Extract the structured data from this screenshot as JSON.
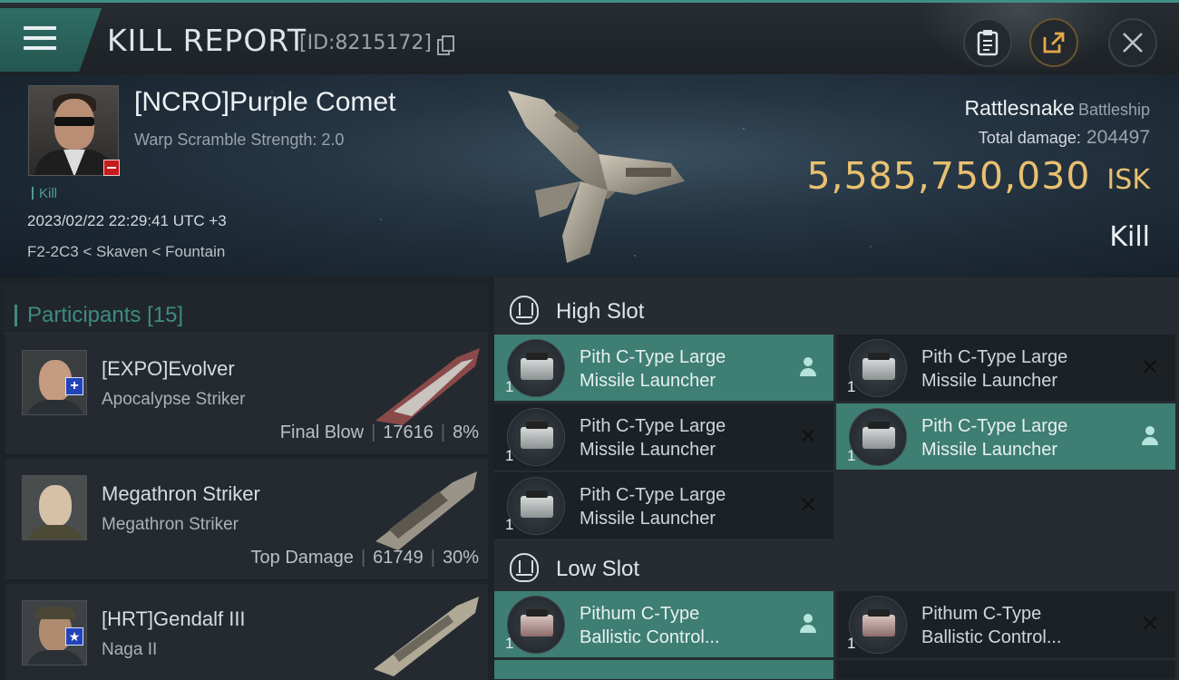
{
  "header": {
    "title": "KILL REPORT",
    "report_id": "[ID:8215172]",
    "icons": {
      "menu": "hamburger-menu-icon",
      "copy": "copy-icon",
      "clipboard": "clipboard-icon",
      "share": "share-icon",
      "close": "close-icon"
    }
  },
  "victim": {
    "name": "[NCRO]Purple Comet",
    "warp_scramble": "Warp Scramble Strength: 2.0",
    "result_tag": "Kill",
    "timestamp": "2023/02/22 22:29:41 UTC +3",
    "location": "F2-2C3 < Skaven < Fountain",
    "ship_name": "Rattlesnake",
    "ship_class": "Battleship",
    "total_damage_label": "Total damage:",
    "total_damage": "204497",
    "isk_value": "5,585,750,030",
    "isk_unit": "ISK",
    "result": "Kill"
  },
  "participants": {
    "title": "Participants",
    "count": "[15]",
    "list": [
      {
        "name": "[EXPO]Evolver",
        "ship": "Apocalypse Striker",
        "role": "Final Blow",
        "damage": "17616",
        "percent": "8%",
        "badge": "+"
      },
      {
        "name": "Megathron Striker",
        "ship": "Megathron Striker",
        "role": "Top Damage",
        "damage": "61749",
        "percent": "30%",
        "badge": ""
      },
      {
        "name": "[HRT]Gendalf III",
        "ship": "Naga II",
        "role": "",
        "damage": "",
        "percent": "",
        "badge": "★"
      }
    ]
  },
  "fitting": {
    "high_slot": {
      "label": "High Slot",
      "items": [
        {
          "qty": "1",
          "line1": "Pith C-Type Large",
          "line2": "Missile Launcher",
          "status": "dropped"
        },
        {
          "qty": "1",
          "line1": "Pith C-Type Large",
          "line2": "Missile Launcher",
          "status": "destroyed"
        },
        {
          "qty": "1",
          "line1": "Pith C-Type Large",
          "line2": "Missile Launcher",
          "status": "destroyed"
        },
        {
          "qty": "1",
          "line1": "Pith C-Type Large",
          "line2": "Missile Launcher",
          "status": "dropped"
        },
        {
          "qty": "1",
          "line1": "Pith C-Type Large",
          "line2": "Missile Launcher",
          "status": "destroyed"
        }
      ]
    },
    "low_slot": {
      "label": "Low Slot",
      "items": [
        {
          "qty": "1",
          "line1": "Pithum C-Type",
          "line2": "Ballistic Control...",
          "status": "dropped"
        },
        {
          "qty": "1",
          "line1": "Pithum C-Type",
          "line2": "Ballistic Control...",
          "status": "destroyed"
        }
      ]
    }
  },
  "colors": {
    "accent_teal": "#3f8f83",
    "dropped_bg": "#3e7e73",
    "isk_gold": "#e8c070",
    "badge_red": "#c41b1b",
    "badge_blue": "#2344b8"
  }
}
